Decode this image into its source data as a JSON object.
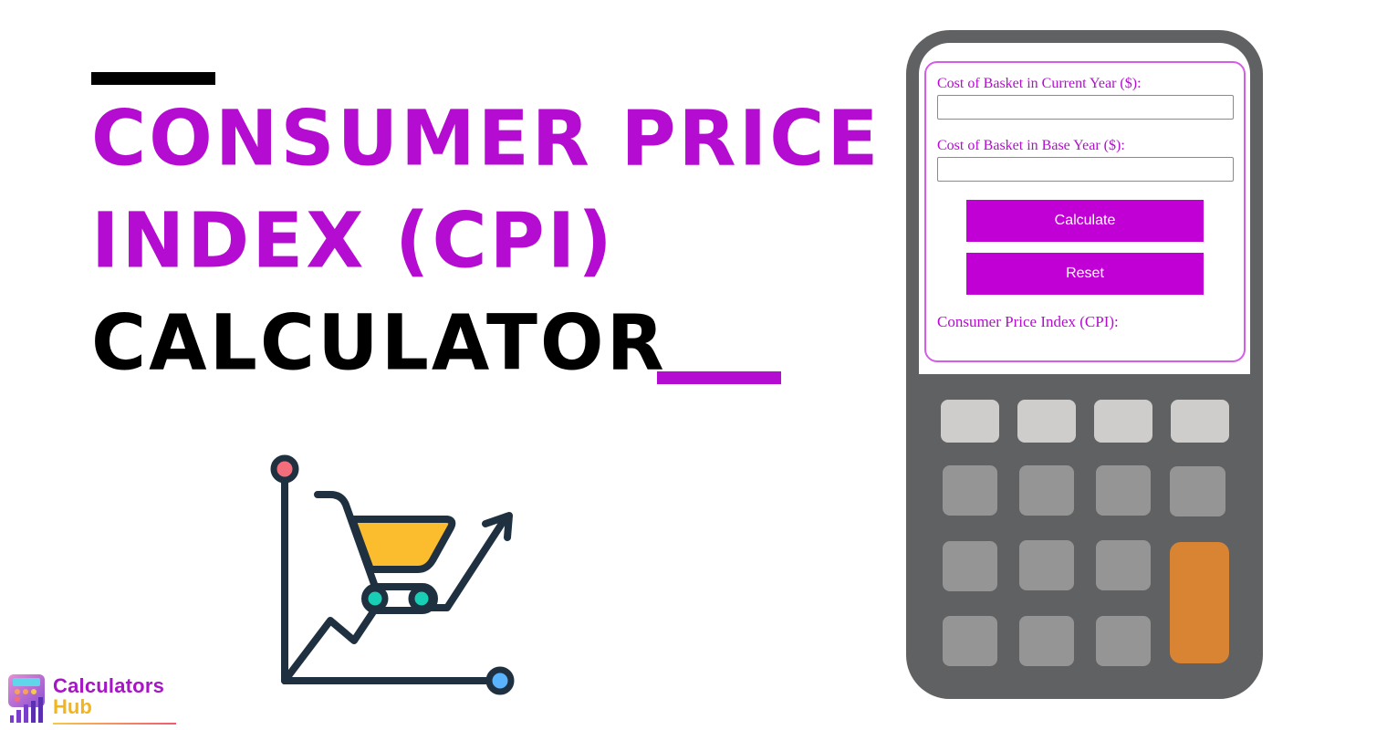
{
  "hero": {
    "title_line1": "CONSUMER PRICE",
    "title_line2": "INDEX (CPI)",
    "title_line3": "CALCULATOR",
    "accent_color": "#b40cd1"
  },
  "calculator": {
    "fields": [
      {
        "label": "Cost of Basket in Current Year ($):",
        "value": "",
        "placeholder": ""
      },
      {
        "label": "Cost of Basket in Base Year ($):",
        "value": "",
        "placeholder": ""
      }
    ],
    "calculate_label": "Calculate",
    "reset_label": "Reset",
    "result_label": "Consumer Price Index (CPI):",
    "result_value": "",
    "button_color": "#c100d6",
    "body_color": "#606162",
    "equals_key_color": "#d98432"
  },
  "illustration": {
    "icon": "shopping-cart-rising-chart-icon"
  },
  "logo": {
    "line1": "Calculators",
    "line2": "Hub",
    "icon": "calculator-bar-chart-icon"
  }
}
